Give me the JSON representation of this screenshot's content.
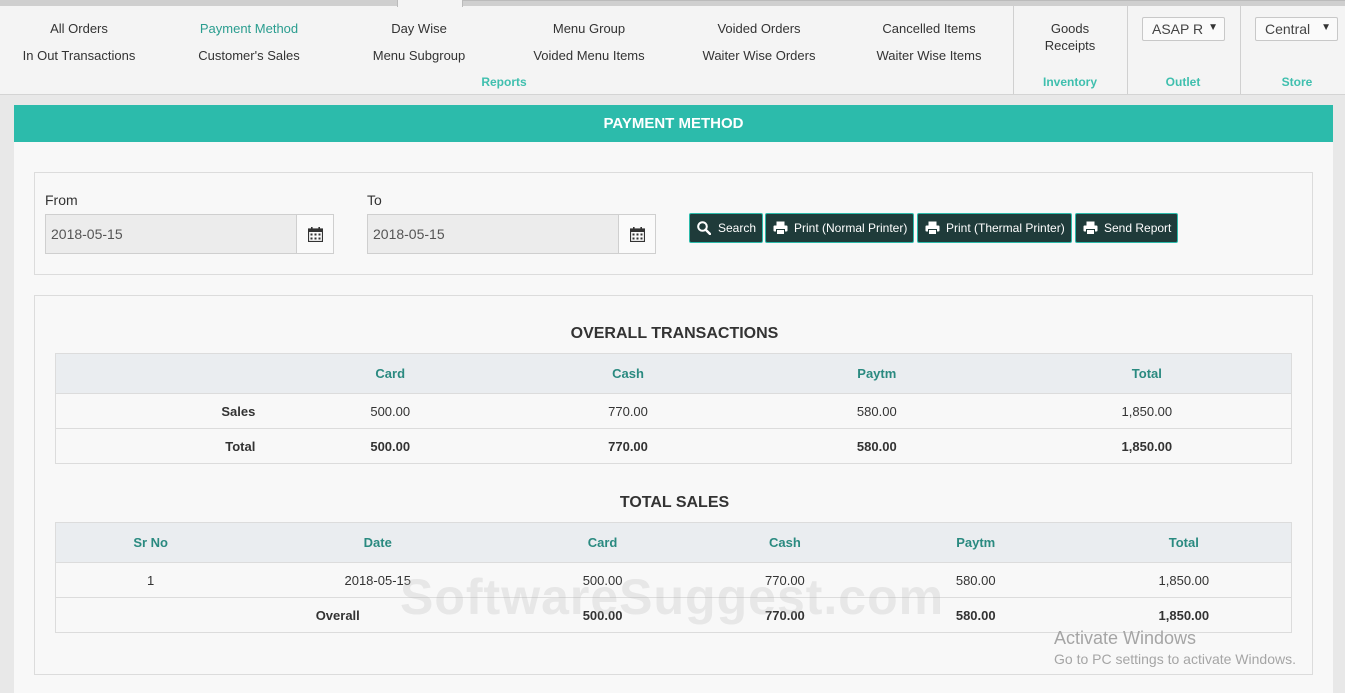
{
  "ribbon": {
    "reports": {
      "row1": [
        "All Orders",
        "Payment Method",
        "Day Wise",
        "Menu Group",
        "Voided Orders",
        "Cancelled Items"
      ],
      "row2": [
        "In Out Transactions",
        "Customer's Sales",
        "Menu Subgroup",
        "Voided Menu Items",
        "Waiter Wise Orders",
        "Waiter Wise Items"
      ],
      "label": "Reports"
    },
    "inventory": {
      "item": "Goods Receipts",
      "item_line1": "Goods",
      "item_line2": "Receipts",
      "label": "Inventory"
    },
    "outlet": {
      "selected": "ASAP R",
      "label": "Outlet"
    },
    "store": {
      "selected": "Central",
      "label": "Store"
    }
  },
  "panel": {
    "title": "PAYMENT METHOD",
    "filters": {
      "from_label": "From",
      "from_value": "2018-05-15",
      "to_label": "To",
      "to_value": "2018-05-15"
    },
    "buttons": {
      "search": "Search",
      "print_normal": "Print (Normal Printer)",
      "print_thermal": "Print (Thermal Printer)",
      "send_report": "Send Report"
    },
    "overall": {
      "title": "OVERALL TRANSACTIONS",
      "headers": [
        "",
        "Card",
        "Cash",
        "Paytm",
        "Total"
      ],
      "rows": [
        [
          "Sales",
          "500.00",
          "770.00",
          "580.00",
          "1,850.00"
        ],
        [
          "Total",
          "500.00",
          "770.00",
          "580.00",
          "1,850.00"
        ]
      ]
    },
    "total_sales": {
      "title": "TOTAL SALES",
      "headers": [
        "Sr No",
        "Date",
        "Card",
        "Cash",
        "Paytm",
        "Total"
      ],
      "rows": [
        [
          "1",
          "2018-05-15",
          "500.00",
          "770.00",
          "580.00",
          "1,850.00"
        ],
        [
          "",
          "Overall",
          "500.00",
          "770.00",
          "580.00",
          "1,850.00"
        ]
      ]
    }
  },
  "watermark": "SoftwareSuggest.com",
  "os_overlay": {
    "line1": "Activate Windows",
    "line2": "Go to PC settings to activate Windows."
  },
  "colors": {
    "accent": "#2cbbab",
    "button_bg": "#1f3b3a",
    "header_text": "#2a8a80"
  }
}
